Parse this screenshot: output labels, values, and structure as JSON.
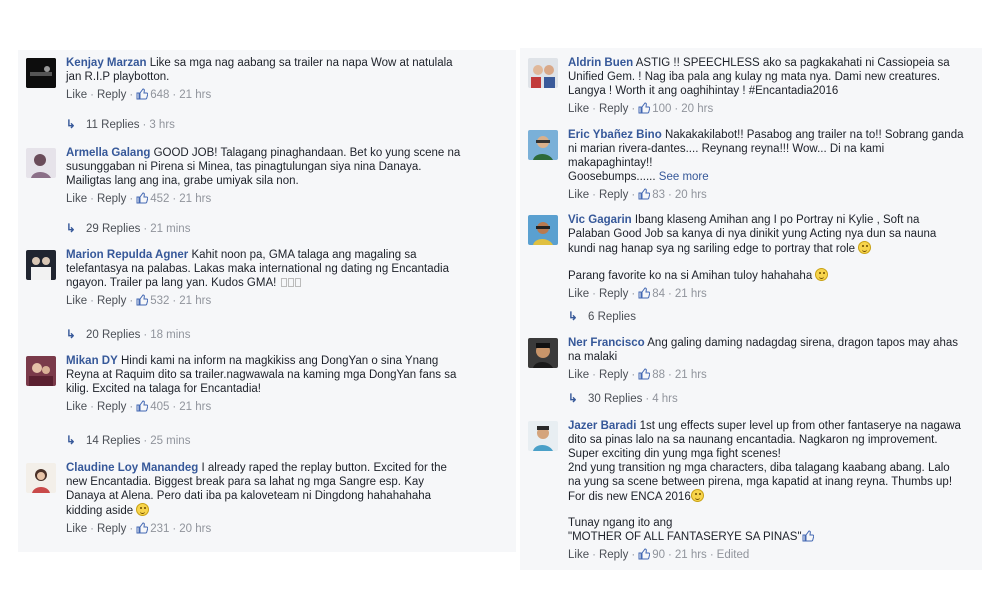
{
  "labels": {
    "like": "Like",
    "reply": "Reply",
    "edited": "Edited"
  },
  "left_comments": [
    {
      "name": "Kenjay Marzan",
      "lines": [
        "Like sa mga nag aabang sa trailer na napa Wow at natulala",
        "jan R.I.P playbotton."
      ],
      "likes": "648",
      "time": "21 hrs",
      "replies": "11 Replies",
      "replies_time": "3 hrs"
    },
    {
      "name": "Armella Galang",
      "lines": [
        "GOOD JOB! Talagang pinaghandaan. Bet ko yung scene na",
        "susunggaban ni Pirena si Minea, tas pinagtulungan siya nina Danaya.",
        "Mailigtas lang ang ina, grabe umiyak sila non."
      ],
      "likes": "452",
      "time": "21 hrs",
      "replies": "29 Replies",
      "replies_time": "21 mins"
    },
    {
      "name": "Marion Repulda Agner",
      "lines": [
        "Kahit noon pa, GMA talaga ang magaling sa",
        "telefantasya na palabas. Lakas maka international ng dating ng Encantadia",
        "ngayon. Trailer pa lang yan. Kudos GMA!"
      ],
      "likes": "532",
      "time": "21 hrs",
      "replies": "20 Replies",
      "replies_time": "18 mins"
    },
    {
      "name": "Mikan DY",
      "lines": [
        "Hindi kami na inform na magkikiss ang DongYan o sina Ynang",
        "Reyna at Raquim dito sa trailer.nagwawala na kaming mga DongYan fans sa",
        "kilig. Excited na talaga for Encantadia!"
      ],
      "likes": "405",
      "time": "21 hrs",
      "replies": "14 Replies",
      "replies_time": "25 mins"
    },
    {
      "name": "Claudine Loy Manandeg",
      "lines": [
        "I already raped the replay button. Excited for the",
        "new Encantadia. Biggest break para sa lahat ng mga Sangre esp. Kay",
        "Danaya at Alena. Pero dati iba pa kaloveteam ni Dingdong hahahahaha",
        "kidding aside"
      ],
      "likes": "231",
      "time": "20 hrs"
    }
  ],
  "right_comments": [
    {
      "name": "Aldrin Buen",
      "lines": [
        "ASTIG !! SPEECHLESS ako sa pagkakahati ni Cassiopeia sa",
        "Unified Gem. ! Nag iba pala ang kulay ng mata nya. Dami new creatures.",
        "Langya ! Worth it ang oaghihintay ! #Encantadia2016"
      ],
      "likes": "100",
      "time": "20 hrs"
    },
    {
      "name": "Eric Ybañez Bino",
      "lines": [
        "Nakakakilabot!! Pasabog ang trailer na to!! Sobrang ganda",
        "ni marian rivera-dantes.... Reynang reyna!!! Wow... Di na kami",
        "makapaghintay!!",
        "Goosebumps......"
      ],
      "see_more": "See more",
      "likes": "83",
      "time": "20 hrs"
    },
    {
      "name": "Vic Gagarin",
      "lines": [
        "Ibang klaseng Amihan ang I po Portray ni Kylie , Soft na",
        "Palaban Good Job sa kanya di nya dinikit yung Acting nya dun sa nauna",
        "kundi nag hanap sya ng sariling edge to portray that role"
      ],
      "extra": "Parang favorite ko na si Amihan tuloy hahahaha",
      "likes": "84",
      "time": "21 hrs",
      "replies": "6 Replies",
      "replies_time": ""
    },
    {
      "name": "Ner Francisco",
      "lines": [
        "Ang galing daming nadagdag sirena, dragon tapos may ahas",
        "na malaki"
      ],
      "likes": "88",
      "time": "21 hrs",
      "replies": "30 Replies",
      "replies_time": "4 hrs"
    },
    {
      "name": "Jazer Baradi",
      "lines": [
        "1st ung effects super level up from other fantaserye na nagawa",
        "dito sa pinas lalo na sa naunang encantadia. Nagkaron ng improvement.",
        "Super exciting din yung mga fight scenes!",
        "2nd yung transition ng mga characters, diba talagang kaabang abang. Lalo",
        "na yung sa scene between pirena, mga kapatid at inang reyna. Thumbs up!",
        "For dis new ENCA 2016"
      ],
      "extra_lines": [
        "Tunay ngang ito ang",
        "\"MOTHER OF ALL FANTASERYE SA PINAS\""
      ],
      "likes": "90",
      "time": "21 hrs"
    }
  ]
}
